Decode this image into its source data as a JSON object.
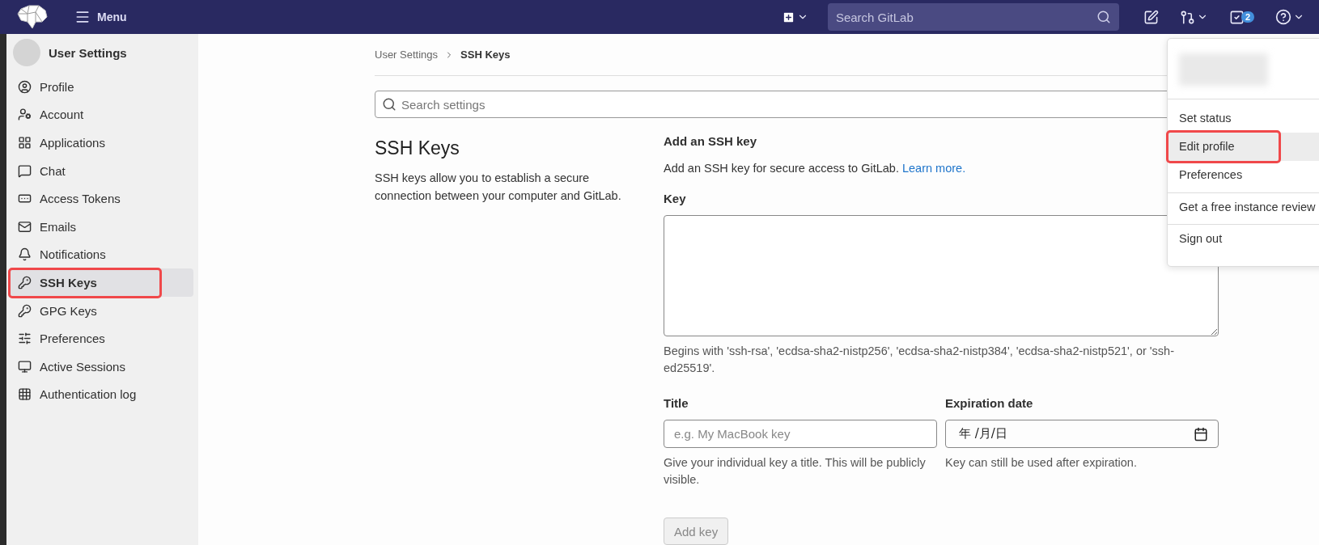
{
  "topbar": {
    "menu_label": "Menu",
    "search": {
      "placeholder": "Search GitLab"
    },
    "todo_count": "2"
  },
  "sidebar": {
    "title": "User Settings",
    "items": [
      {
        "label": "Profile",
        "kind": "profile",
        "selected": false,
        "annotated": false
      },
      {
        "label": "Account",
        "kind": "account",
        "selected": false,
        "annotated": false
      },
      {
        "label": "Applications",
        "kind": "applications",
        "selected": false,
        "annotated": false
      },
      {
        "label": "Chat",
        "kind": "chat",
        "selected": false,
        "annotated": false
      },
      {
        "label": "Access Tokens",
        "kind": "token",
        "selected": false,
        "annotated": false
      },
      {
        "label": "Emails",
        "kind": "email",
        "selected": false,
        "annotated": false
      },
      {
        "label": "Notifications",
        "kind": "bell",
        "selected": false,
        "annotated": false
      },
      {
        "label": "SSH Keys",
        "kind": "key",
        "selected": true,
        "annotated": true
      },
      {
        "label": "GPG Keys",
        "kind": "key",
        "selected": false,
        "annotated": false
      },
      {
        "label": "Preferences",
        "kind": "preferences",
        "selected": false,
        "annotated": false
      },
      {
        "label": "Active Sessions",
        "kind": "monitor",
        "selected": false,
        "annotated": false
      },
      {
        "label": "Authentication log",
        "kind": "log",
        "selected": false,
        "annotated": false
      }
    ]
  },
  "breadcrumb": [
    "User Settings",
    "SSH Keys"
  ],
  "settings_search": {
    "placeholder": "Search settings"
  },
  "section": {
    "title": "SSH Keys",
    "description": "SSH keys allow you to establish a secure connection between your computer and GitLab."
  },
  "form": {
    "heading": "Add an SSH key",
    "intro": "Add an SSH key for secure access to GitLab.",
    "intro_link": "Learn more.",
    "key_label": "Key",
    "key_help": "Begins with 'ssh-rsa', 'ecdsa-sha2-nistp256', 'ecdsa-sha2-nistp384', 'ecdsa-sha2-nistp521', or 'ssh-ed25519'.",
    "title_label": "Title",
    "title_placeholder": "e.g. My MacBook key",
    "title_help": "Give your individual key a title. This will be publicly visible.",
    "expiration_label": "Expiration date",
    "expiration_placeholder": "年 /月/日",
    "expiration_help": "Key can still be used after expiration.",
    "submit": {
      "label": "Add key",
      "disabled": true
    }
  },
  "user_menu": {
    "items": [
      {
        "label": "Set status",
        "selected": false,
        "annotated": false,
        "divider_before": false
      },
      {
        "label": "Edit profile",
        "selected": true,
        "annotated": true,
        "divider_before": false
      },
      {
        "label": "Preferences",
        "selected": false,
        "annotated": false,
        "divider_before": false
      },
      {
        "label": "Get a free instance review",
        "selected": false,
        "annotated": false,
        "divider_before": true
      },
      {
        "label": "Sign out",
        "selected": false,
        "annotated": false,
        "divider_before": true
      }
    ]
  }
}
